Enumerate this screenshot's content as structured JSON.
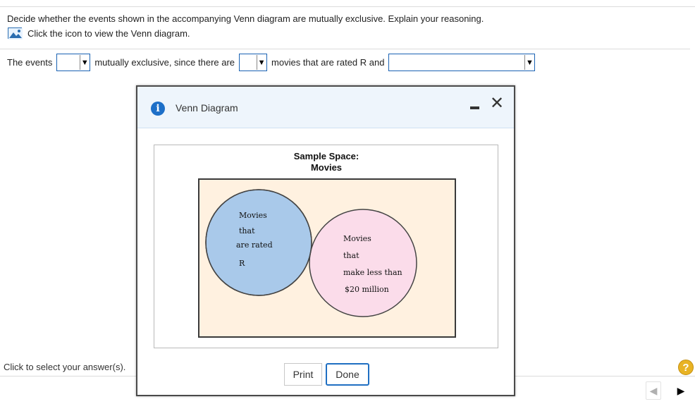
{
  "question": {
    "text": "Decide whether the events shown in the accompanying Venn diagram are mutually exclusive. Explain your reasoning.",
    "icon_link": "Click the icon to view the Venn diagram."
  },
  "answer": {
    "part1": "The events",
    "part2": "mutually exclusive, since there are",
    "part3": "movies that are rated R and",
    "dropdown1_value": "",
    "dropdown2_value": "",
    "dropdown3_value": ""
  },
  "footer": {
    "hint": "Click to select your answer(s).",
    "help": "?"
  },
  "modal": {
    "title": "Venn Diagram",
    "print_label": "Print",
    "done_label": "Done",
    "diagram": {
      "sample_space_line1": "Sample Space:",
      "sample_space_line2": "Movies",
      "circle_a": [
        "Movies",
        "that",
        "are rated",
        "R"
      ],
      "circle_b": [
        "Movies",
        "that",
        "make less than",
        "$20 million"
      ]
    }
  },
  "colors": {
    "accent": "#1d6fc8",
    "circle_a": "#a9c9ea",
    "circle_b": "#fbdcea",
    "overlap": "#9b94c8",
    "sample_bg": "#fff1e0"
  }
}
